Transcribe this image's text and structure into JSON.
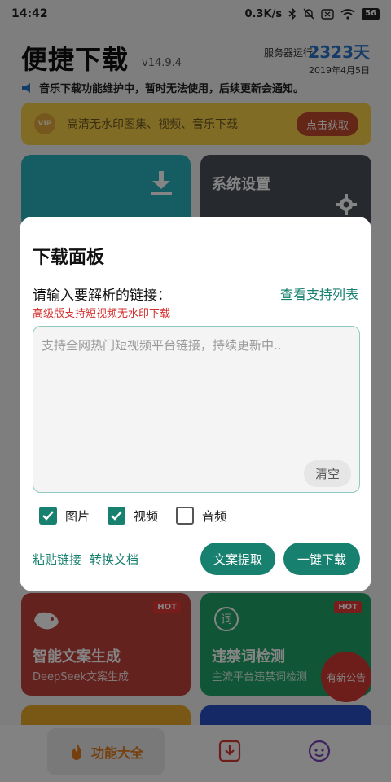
{
  "status_bar": {
    "time": "14:42",
    "speed": "0.3K/s",
    "battery": "56"
  },
  "header": {
    "title": "便捷下载",
    "version": "v14.9.4",
    "server_label": "服务器运行",
    "server_days": "2323天",
    "server_date": "2019年4月5日",
    "notice": "音乐下载功能维护中，暂时无法使用，后续更新会通知。"
  },
  "vip_banner": {
    "badge": "VIP",
    "text": "高清无水印图集、视频、音乐下载",
    "button": "点击获取"
  },
  "cards": {
    "system_settings": "系统设置",
    "smart_copy": {
      "title": "智能文案生成",
      "subtitle": "DeepSeek文案生成",
      "badge": "HOT"
    },
    "banned_words": {
      "title": "违禁词检测",
      "subtitle": "主流平台违禁词检测",
      "badge": "HOT"
    }
  },
  "notice_float": "有新公告",
  "bottom_nav": {
    "functions": "功能大全"
  },
  "dialog": {
    "title": "下载面板",
    "input_label": "请输入要解析的链接：",
    "support_list_link": "查看支持列表",
    "warning": "高级版支持短视频无水印下载",
    "placeholder": "支持全网热门短视频平台链接，持续更新中..",
    "clear_button": "清空",
    "options": [
      {
        "label": "图片",
        "checked": true
      },
      {
        "label": "视频",
        "checked": true
      },
      {
        "label": "音频",
        "checked": false
      }
    ],
    "paste_link": "粘贴链接",
    "convert_doc": "转换文档",
    "extract_copy_button": "文案提取",
    "one_click_download_button": "一键下载"
  },
  "colors": {
    "accent": "#17806f",
    "warning": "#d32f2f",
    "server_days": "#2a73c9"
  }
}
